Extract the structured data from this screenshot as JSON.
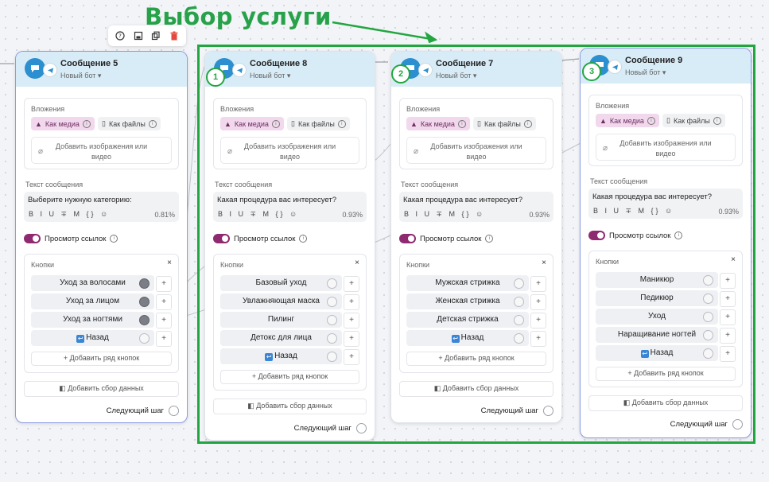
{
  "annotation": {
    "title": "Выбор услуги"
  },
  "toolbar": {
    "icons": [
      "help-icon",
      "save-icon",
      "copy-icon",
      "delete-icon"
    ]
  },
  "common": {
    "attachments_label": "Вложения",
    "as_media": "Как медиа",
    "as_files": "Как файлы",
    "add_images_line1": "Добавить изображения или",
    "add_images_line2": "видео",
    "message_text_label": "Текст сообщения",
    "format_icons": "B I U ∓ M {} ☺",
    "preview_links": "Просмотр ссылок",
    "buttons_label": "Кнопки",
    "add_button_row": "+ Добавить ряд кнопок",
    "add_data_collect": "Добавить сбор данных",
    "next_step": "Следующий шаг",
    "close": "×",
    "plus": "+"
  },
  "cards": [
    {
      "title": "Сообщение 5",
      "bot": "Новый бот ▾",
      "text": "Выберите нужную категорию:",
      "percent": "0.81%",
      "buttons": [
        "Уход за волосами",
        "Уход за лицом",
        "Уход за ногтями",
        "Назад"
      ]
    },
    {
      "title": "Сообщение 8",
      "bot": "Новый бот ▾",
      "badge": "1",
      "text": "Какая процедура вас интересует?",
      "percent": "0.93%",
      "buttons": [
        "Базовый уход",
        "Увлажняющая маска",
        "Пилинг",
        "Детокс для лица",
        "Назад"
      ]
    },
    {
      "title": "Сообщение 7",
      "bot": "Новый бот ▾",
      "badge": "2",
      "text": "Какая процедура вас интересует?",
      "percent": "0.93%",
      "buttons": [
        "Мужская стрижка",
        "Женская стрижка",
        "Детская стрижка",
        "Назад"
      ]
    },
    {
      "title": "Сообщение 9",
      "bot": "Новый бот ▾",
      "badge": "3",
      "text": "Какая процедура вас интересует?",
      "percent": "0.93%",
      "buttons": [
        "Маникюр",
        "Педикюр",
        "Уход",
        "Наращивание ногтей",
        "Назад"
      ]
    }
  ],
  "colors": {
    "annotation": "#22a640",
    "accent": "#8e2a6f",
    "header": "#d8ecf7"
  }
}
